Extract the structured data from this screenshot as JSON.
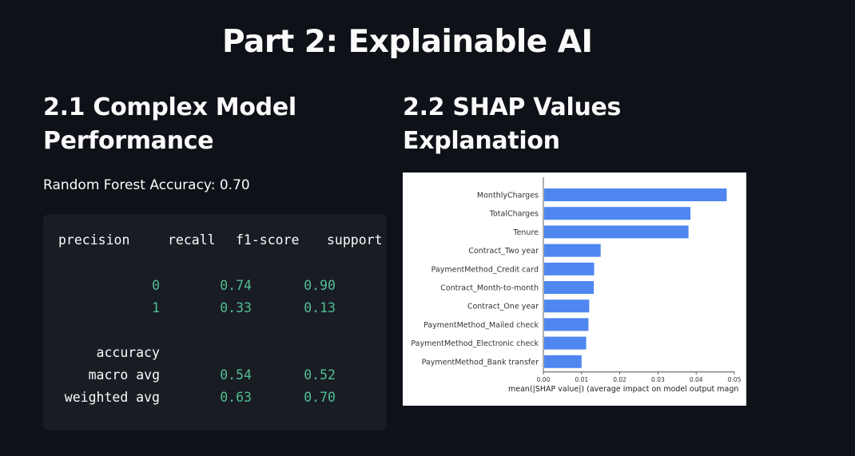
{
  "page": {
    "title": "Part 2: Explainable AI"
  },
  "left": {
    "heading": "2.1 Complex Model Performance",
    "accuracy_text": "Random Forest Accuracy: 0.70",
    "report": {
      "headers": [
        "precision",
        "recall",
        "f1-score",
        "support"
      ],
      "rows": [
        {
          "label": "0",
          "precision": "0.74",
          "recall": "0.90"
        },
        {
          "label": "1",
          "precision": "0.33",
          "recall": "0.13"
        },
        {
          "label": "accuracy",
          "precision": "",
          "recall": ""
        },
        {
          "label": "macro avg",
          "precision": "0.54",
          "recall": "0.52"
        },
        {
          "label": "weighted avg",
          "precision": "0.63",
          "recall": "0.70"
        }
      ]
    }
  },
  "right": {
    "heading": "2.2 SHAP Values Explanation"
  },
  "chart_data": {
    "type": "bar",
    "orientation": "horizontal",
    "categories": [
      "MonthlyCharges",
      "TotalCharges",
      "Tenure",
      "Contract_Two year",
      "PaymentMethod_Credit card",
      "Contract_Month-to-month",
      "Contract_One year",
      "PaymentMethod_Mailed check",
      "PaymentMethod_Electronic check",
      "PaymentMethod_Bank transfer"
    ],
    "values": [
      0.048,
      0.0385,
      0.038,
      0.015,
      0.0133,
      0.0132,
      0.012,
      0.0118,
      0.0112,
      0.01
    ],
    "xlabel": "mean(|SHAP value|) (average impact on model output magn",
    "xlim": [
      0,
      0.05
    ],
    "xticks": [
      "0.00",
      "0.01",
      "0.02",
      "0.03",
      "0.04",
      "0.05"
    ],
    "bar_color": "#4f86f0",
    "grid": false
  }
}
